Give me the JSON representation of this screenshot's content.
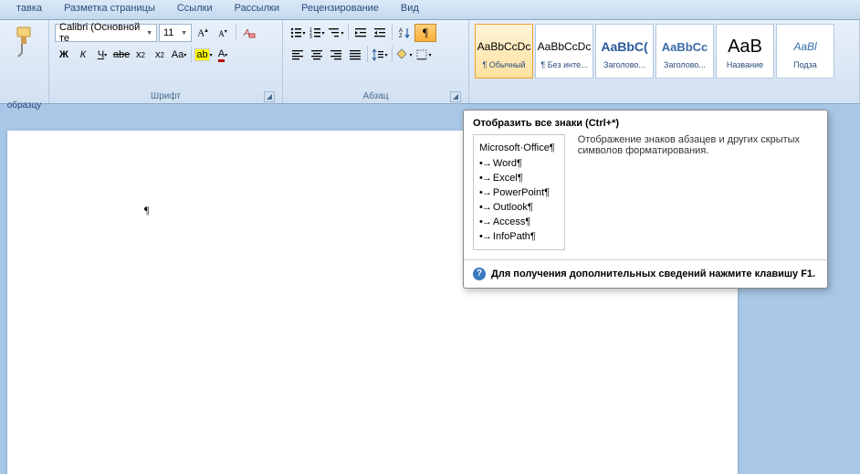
{
  "tabs": [
    "тавка",
    "Разметка страницы",
    "Ссылки",
    "Рассылки",
    "Рецензирование",
    "Вид"
  ],
  "clipboard": {
    "label": "образцу"
  },
  "font": {
    "name": "Calibri (Основной те",
    "size": "11",
    "group_label": "Шрифт"
  },
  "paragraph": {
    "group_label": "Абзац"
  },
  "styles": [
    {
      "preview": "AaBbCcDc",
      "name": "¶ Обычный",
      "color": "#000",
      "size": "12px",
      "selected": true
    },
    {
      "preview": "AaBbCcDc",
      "name": "¶ Без инте...",
      "color": "#000",
      "size": "12px"
    },
    {
      "preview": "AaBbC(",
      "name": "Заголово...",
      "color": "#2a5a9c",
      "size": "14px",
      "bold": true
    },
    {
      "preview": "AaBbCc",
      "name": "Заголово...",
      "color": "#3a6bac",
      "size": "13px",
      "bold": true
    },
    {
      "preview": "AaB",
      "name": "Название",
      "color": "#000",
      "size": "20px"
    },
    {
      "preview": "AaBl",
      "name": "Подза",
      "color": "#3a6bac",
      "size": "12px",
      "italic": true
    }
  ],
  "tooltip": {
    "title": "Отобразить все знаки (Ctrl+*)",
    "list_title": "Microsoft·Office¶",
    "items": [
      "Word¶",
      "Excel¶",
      "PowerPoint¶",
      "Outlook¶",
      "Access¶",
      "InfoPath¶"
    ],
    "description": "Отображение знаков абзацев и других скрытых символов форматирования.",
    "footer": "Для получения дополнительных сведений нажмите клавишу F1."
  },
  "document": {
    "para_mark": "¶"
  }
}
